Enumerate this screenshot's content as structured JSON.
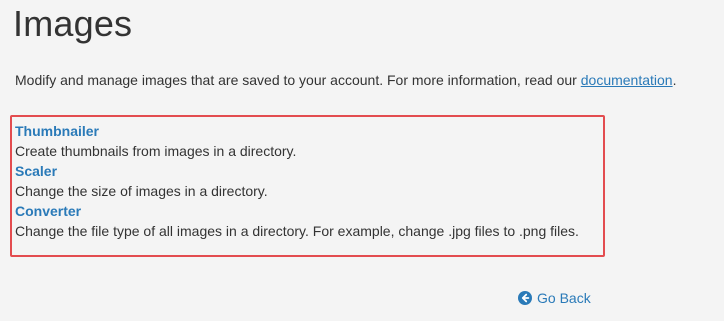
{
  "page": {
    "title": "Images",
    "intro_text": "Modify and manage images that are saved to your account. For more information, read our ",
    "documentation_link": "documentation",
    "intro_suffix": "."
  },
  "tools": [
    {
      "name": "Thumbnailer",
      "description": "Create thumbnails from images in a directory."
    },
    {
      "name": "Scaler",
      "description": "Change the size of images in a directory."
    },
    {
      "name": "Converter",
      "description": "Change the file type of all images in a directory. For example, change .jpg files to .png files."
    }
  ],
  "navigation": {
    "go_back_label": "Go Back",
    "go_back_icon": "arrow-circle-left-icon"
  },
  "colors": {
    "link": "#2a7ab8",
    "highlight_border": "#e34c4f",
    "text": "#333333",
    "background": "#f4f4f4"
  }
}
